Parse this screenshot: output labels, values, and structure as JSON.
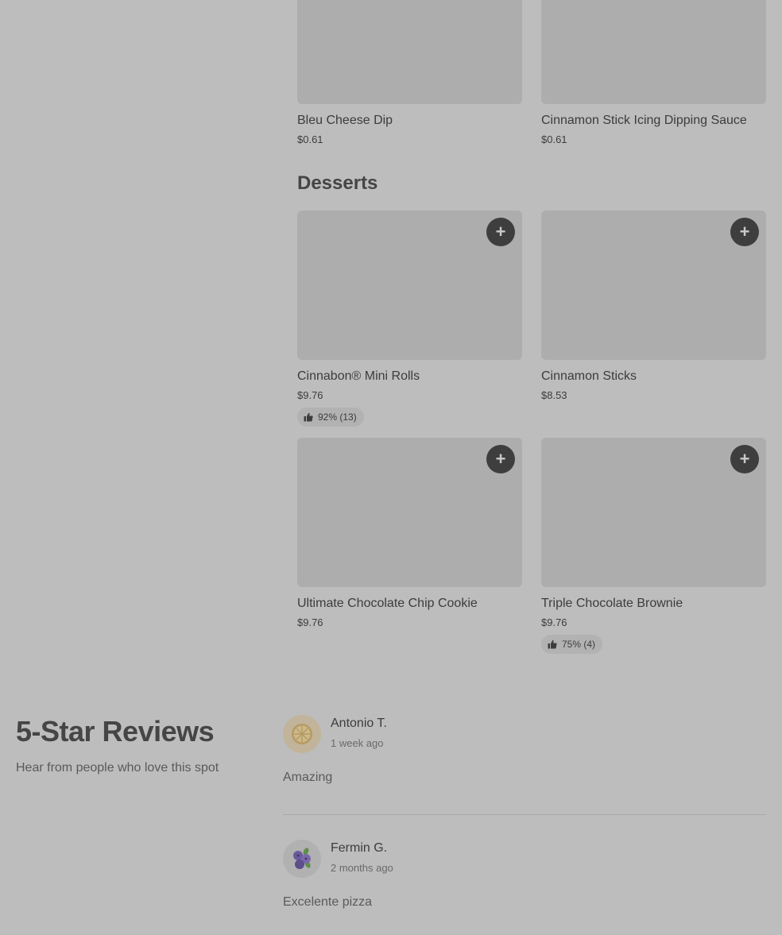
{
  "sides": [
    {
      "name": "Bleu Cheese Dip",
      "price": "$0.61"
    },
    {
      "name": "Cinnamon Stick Icing Dipping Sauce",
      "price": "$0.61"
    }
  ],
  "desserts": {
    "title": "Desserts",
    "items": [
      {
        "name": "Cinnabon® Mini Rolls",
        "price": "$9.76",
        "rating": "92% (13)"
      },
      {
        "name": "Cinnamon Sticks",
        "price": "$8.53"
      },
      {
        "name": "Ultimate Chocolate Chip Cookie",
        "price": "$9.76"
      },
      {
        "name": "Triple Chocolate Brownie",
        "price": "$9.76",
        "rating": "75% (4)"
      }
    ],
    "add_icon": "plus-icon",
    "add_symbol": "+"
  },
  "reviews": {
    "title": "5-Star Reviews",
    "subtitle": "Hear from people who love this spot",
    "items": [
      {
        "name": "Antonio T.",
        "time": "1 week ago",
        "text": "Amazing",
        "avatar_icon": "lemon-avatar-icon"
      },
      {
        "name": "Fermin G.",
        "time": "2 months ago",
        "text": "Excelente pizza",
        "avatar_icon": "blueberry-avatar-icon"
      }
    ]
  },
  "colors": {
    "background": "#bdbdbd",
    "image_placeholder": "#adadad",
    "add_button": "#3e3e3e"
  }
}
